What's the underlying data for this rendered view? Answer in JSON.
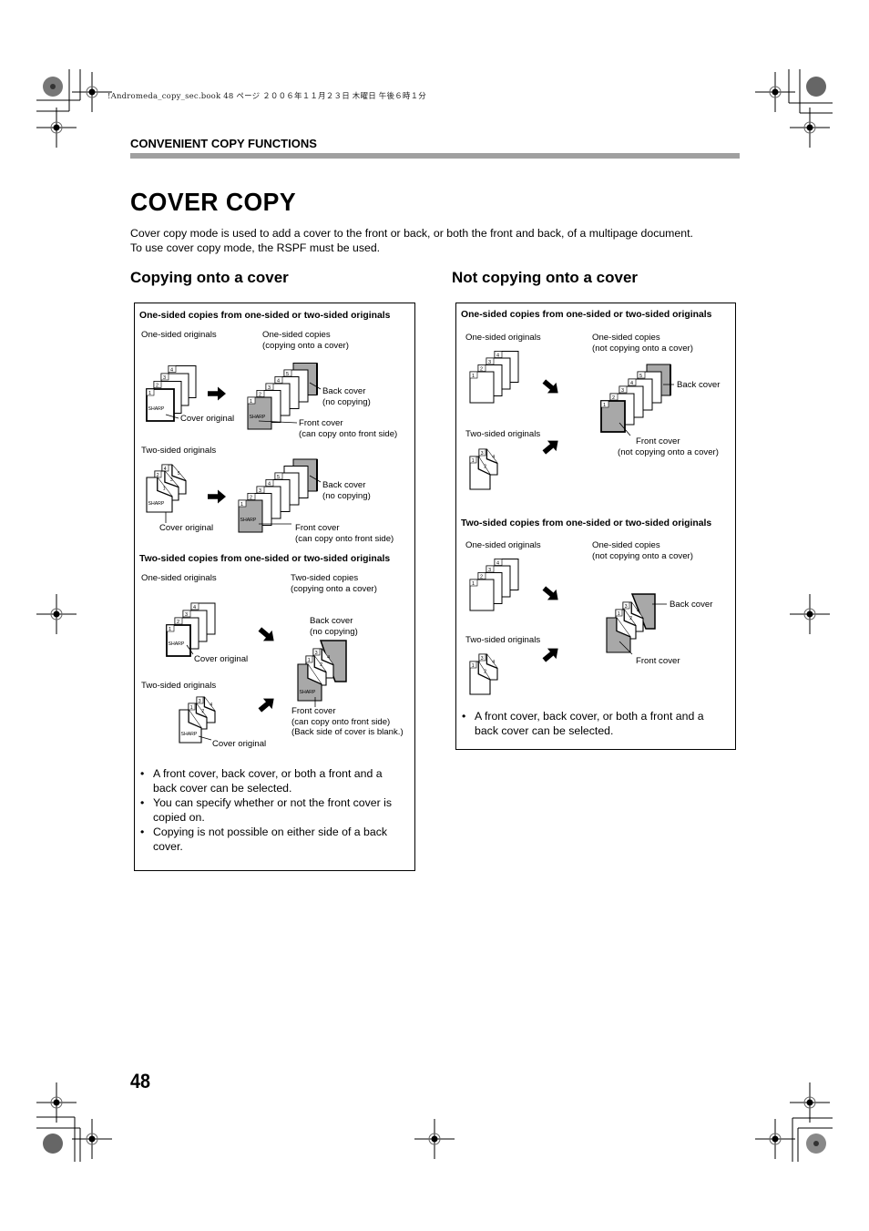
{
  "print_header": "!Andromeda_copy_sec.book  48 ページ  ２００６年１１月２３日  木曜日  午後６時１分",
  "section_label": "CONVENIENT COPY FUNCTIONS",
  "page_title": "COVER  COPY",
  "intro": {
    "line1": "Cover copy mode is used to add a cover to the front or back, or both the front and back, of a multipage document.",
    "line2": "To use cover copy mode, the RSPF must be used."
  },
  "left_panel": {
    "title": "Copying onto a cover",
    "section1": {
      "heading": "One-sided copies from one-sided or two-sided originals",
      "one_sided_originals": "One-sided originals",
      "copies_label_1": "One-sided copies",
      "copies_label_2": "(copying onto a cover)",
      "back_cover_1": "Back cover",
      "back_cover_2": "(no copying)",
      "cover_original": "Cover original",
      "front_cover_1": "Front cover",
      "front_cover_2": "(can copy onto front side)",
      "two_sided_originals": "Two-sided originals",
      "back_cover_b1": "Back cover",
      "back_cover_b2": "(no copying)",
      "cover_original_b": "Cover original",
      "front_cover_b1": "Front cover",
      "front_cover_b2": "(can copy onto front side)"
    },
    "section2": {
      "heading": "Two-sided copies from one-sided or two-sided originals",
      "one_sided_originals": "One-sided originals",
      "copies_label_1": "Two-sided copies",
      "copies_label_2": "(copying onto a cover)",
      "back_cover_1": "Back cover",
      "back_cover_2": "(no copying)",
      "cover_original": "Cover original",
      "two_sided_originals": "Two-sided originals",
      "front_cover_1": "Front cover",
      "front_cover_2": "(can copy onto front side)",
      "front_cover_3": "(Back side of cover is blank.)",
      "cover_original_b": "Cover original"
    },
    "bullets": [
      "A front cover, back cover, or both a front and a back cover can be selected.",
      "You can specify whether or not the front cover is copied on.",
      "Copying is not possible on either side of a back cover."
    ]
  },
  "right_panel": {
    "title": "Not copying onto a cover",
    "section1": {
      "heading": "One-sided copies from one-sided or two-sided originals",
      "one_sided_originals": "One-sided originals",
      "copies_label_1": "One-sided copies",
      "copies_label_2": "(not copying onto a cover)",
      "back_cover": "Back cover",
      "two_sided_originals": "Two-sided originals",
      "front_cover_1": "Front cover",
      "front_cover_2": "(not copying onto a cover)"
    },
    "section2": {
      "heading": "Two-sided copies from one-sided or two-sided originals",
      "one_sided_originals": "One-sided originals",
      "copies_label_1": "One-sided copies",
      "copies_label_2": "(not copying onto a cover)",
      "back_cover": "Back cover",
      "two_sided_originals": "Two-sided originals",
      "front_cover": "Front cover"
    },
    "bullets": [
      "A front cover, back cover, or both a front and a back cover can be selected."
    ]
  },
  "diagram_text": {
    "brand": "SHARP",
    "page_numbers": [
      "1",
      "2",
      "3",
      "4",
      "5"
    ]
  },
  "page_number": "48",
  "colors": {
    "cover_gray": "#a8a8a8",
    "bar_gray": "#a0a0a0"
  }
}
